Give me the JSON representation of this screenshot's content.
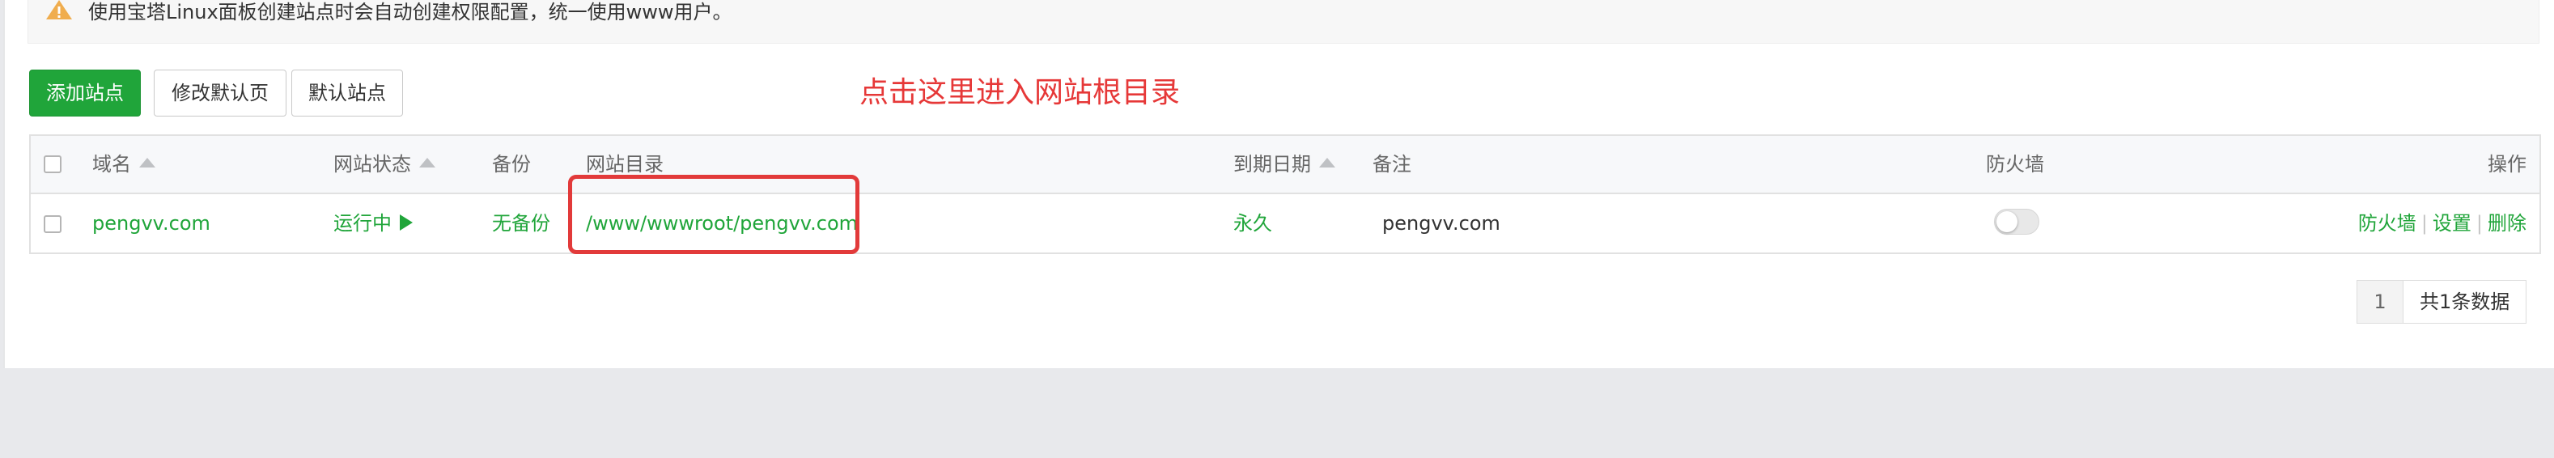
{
  "notice": {
    "text": "使用宝塔Linux面板创建站点时会自动创建权限配置，统一使用www用户。",
    "icon": "warning-icon"
  },
  "toolbar": {
    "add_site": "添加站点",
    "edit_default_page": "修改默认页",
    "default_site": "默认站点"
  },
  "annotation": "点击这里进入网站根目录",
  "table": {
    "headers": {
      "domain": "域名",
      "status": "网站状态",
      "backup": "备份",
      "root_dir": "网站目录",
      "expire": "到期日期",
      "remark": "备注",
      "firewall": "防火墙",
      "actions": "操作"
    },
    "rows": [
      {
        "domain": "pengvv.com",
        "status": "运行中",
        "backup": "无备份",
        "root_dir": "/www/wwwroot/pengvv.com",
        "expire": "永久",
        "remark": "pengvv.com",
        "firewall_enabled": false,
        "actions": {
          "firewall": "防火墙",
          "settings": "设置",
          "delete": "删除"
        },
        "separator": "|"
      }
    ]
  },
  "pagination": {
    "current_page": "1",
    "total": "共1条数据"
  },
  "colors": {
    "accent": "#20a53a",
    "annotation": "#e63838",
    "warning": "#f0ad4e"
  }
}
